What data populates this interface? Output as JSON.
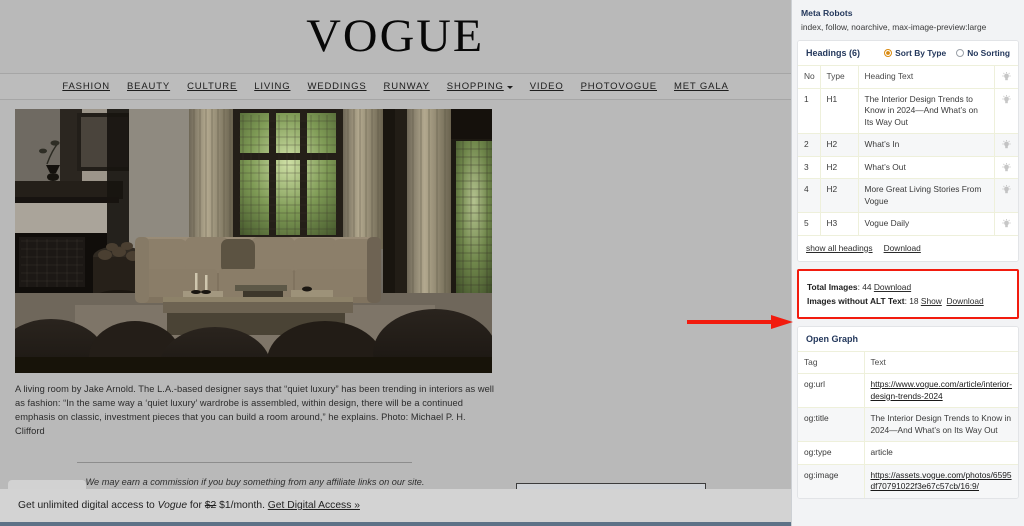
{
  "site": {
    "logo": "VOGUE",
    "nav": [
      {
        "label": "FASHION",
        "has_caret": false
      },
      {
        "label": "BEAUTY",
        "has_caret": false
      },
      {
        "label": "CULTURE",
        "has_caret": false
      },
      {
        "label": "LIVING",
        "has_caret": false
      },
      {
        "label": "WEDDINGS",
        "has_caret": false
      },
      {
        "label": "RUNWAY",
        "has_caret": false
      },
      {
        "label": "SHOPPING",
        "has_caret": true
      },
      {
        "label": "VIDEO",
        "has_caret": false
      },
      {
        "label": "PHOTOVOGUE",
        "has_caret": false
      },
      {
        "label": "MET GALA",
        "has_caret": false
      }
    ],
    "caption": "A living room by Jake Arnold. The L.A.-based designer says that “quiet luxury” has been trending in interiors as well as fashion: “In the same way a ‘quiet luxury’ wardrobe is assembled, within design, there will be a continued emphasis on classic, investment pieces that you can build a room around,” he explains.  Photo: Michael P. H. Clifford",
    "affiliate_note": "We may earn a commission if you buy something from any affiliate links on our site.",
    "subscription": {
      "prefix": "Get unlimited digital access to ",
      "brand": "Vogue",
      "mid": " for ",
      "old_price": "$2",
      "new_price": " $1/month. ",
      "cta": "Get Digital Access »"
    }
  },
  "panel": {
    "meta_robots": {
      "title": "Meta Robots",
      "value": "index, follow, noarchive, max-image-preview:large"
    },
    "headings": {
      "title": "Headings (6)",
      "sort_by_type_label": "Sort By Type",
      "no_sorting_label": "No Sorting",
      "selected_sort": "Sort By Type",
      "columns": [
        "No",
        "Type",
        "Heading Text",
        ""
      ],
      "rows": [
        {
          "no": "1",
          "type": "H1",
          "text": "The Interior Design Trends to Know in 2024—And What’s on Its Way Out"
        },
        {
          "no": "2",
          "type": "H2",
          "text": "What’s In"
        },
        {
          "no": "3",
          "type": "H2",
          "text": "What’s Out"
        },
        {
          "no": "4",
          "type": "H2",
          "text": "More Great Living Stories From Vogue"
        },
        {
          "no": "5",
          "type": "H3",
          "text": "Vogue Daily"
        }
      ],
      "show_all_label": "show all headings",
      "download_label": "Download"
    },
    "images": {
      "total_label": "Total Images",
      "total_value": ": 44 ",
      "total_download": "Download",
      "alt_label": "Images without ALT Text",
      "alt_value": ": 18 ",
      "alt_show": "Show",
      "alt_download": "Download",
      "highlight_color": "#f21b0e"
    },
    "open_graph": {
      "title": "Open Graph",
      "columns": [
        "Tag",
        "Text"
      ],
      "rows": [
        {
          "tag": "og:url",
          "text": "https://www.vogue.com/article/interior-design-trends-2024",
          "is_link": true
        },
        {
          "tag": "og:title",
          "text": "The Interior Design Trends to Know in 2024—And What’s on Its Way Out",
          "is_link": false
        },
        {
          "tag": "og:type",
          "text": "article",
          "is_link": false
        },
        {
          "tag": "og:image",
          "text": "https://assets.vogue.com/photos/6595df70791022f3e67c57cb/16:9/",
          "is_link": true
        }
      ]
    }
  },
  "annotation": {
    "arrow_color": "#f21b0e",
    "arrow_name": "red-arrow-pointing-to-images-section"
  }
}
